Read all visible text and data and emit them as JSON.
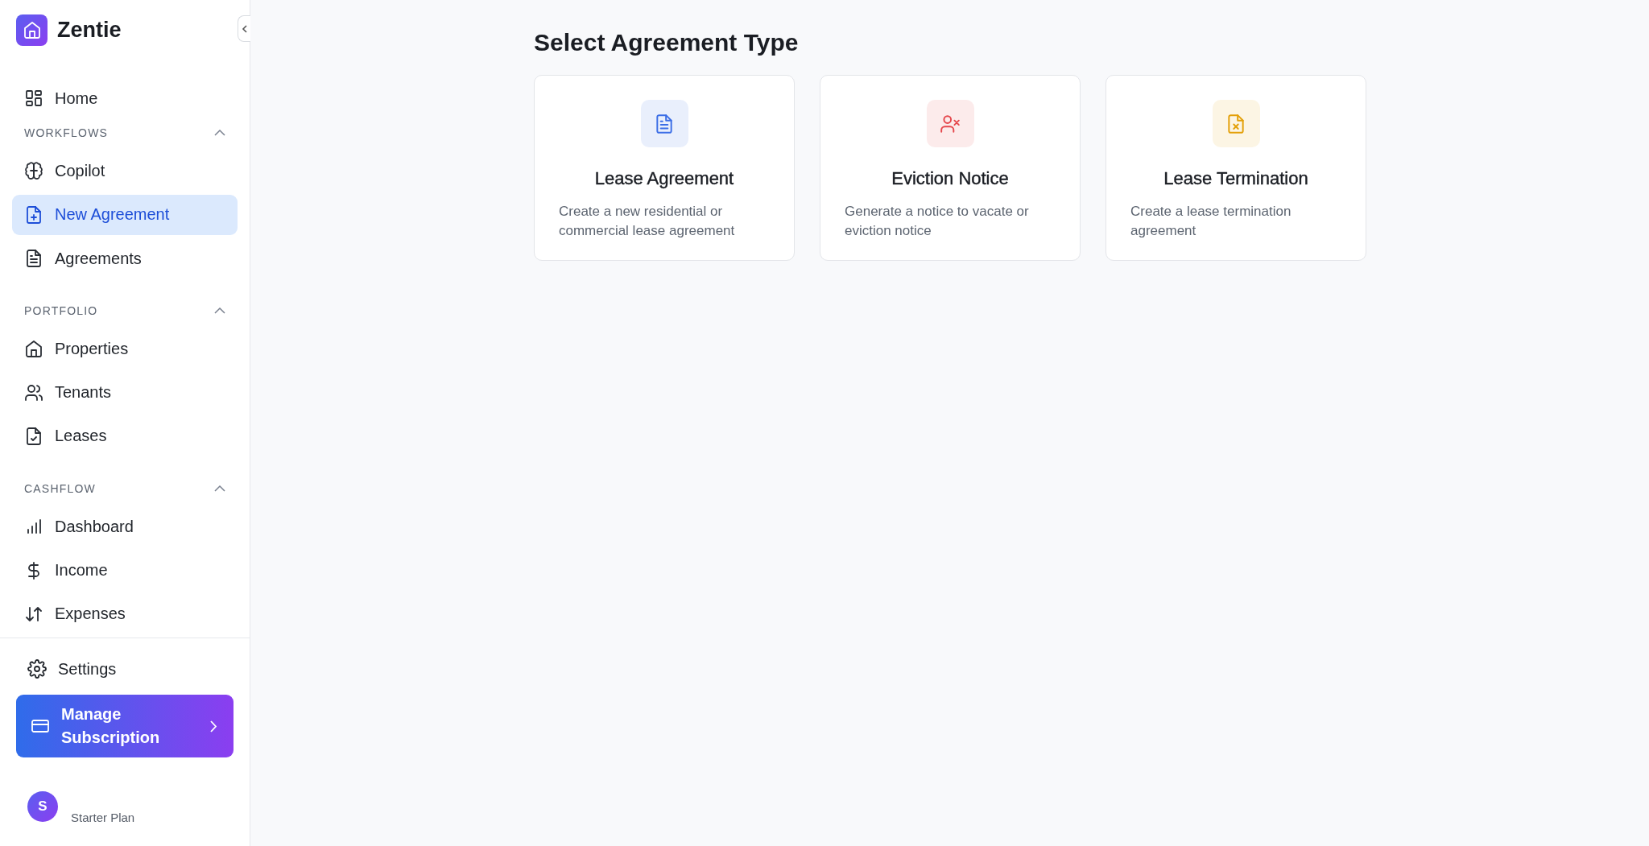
{
  "sidebar": {
    "brand": "Zentie",
    "nav": [
      {
        "kind": "item",
        "label": "Home",
        "selected": false
      },
      {
        "kind": "section",
        "label": "WORKFLOWS",
        "expanded": true
      },
      {
        "kind": "item",
        "label": "Copilot",
        "selected": false
      },
      {
        "kind": "item",
        "label": "New Agreement",
        "selected": true
      },
      {
        "kind": "item",
        "label": "Agreements",
        "selected": false
      },
      {
        "kind": "section",
        "label": "PORTFOLIO",
        "expanded": true
      },
      {
        "kind": "item",
        "label": "Properties",
        "selected": false
      },
      {
        "kind": "item",
        "label": "Tenants",
        "selected": false
      },
      {
        "kind": "item",
        "label": "Leases",
        "selected": false
      },
      {
        "kind": "section",
        "label": "CASHFLOW",
        "expanded": true
      },
      {
        "kind": "item",
        "label": "Dashboard",
        "selected": false
      },
      {
        "kind": "item",
        "label": "Income",
        "selected": false
      },
      {
        "kind": "item",
        "label": "Expenses",
        "selected": false
      }
    ],
    "settings": "Settings",
    "subscription": "Manage Subscription",
    "user": {
      "avatar": "S",
      "plan": "Starter Plan"
    }
  },
  "main": {
    "title": "Select Agreement Type",
    "cards": [
      {
        "title": "Lease Agreement",
        "description": "Create a new residential or commercial lease agreement",
        "color": "#3b6ee6"
      },
      {
        "title": "Eviction Notice",
        "description": "Generate a notice to vacate or eviction notice",
        "color": "#e5484d"
      },
      {
        "title": "Lease Termination",
        "description": "Create a lease termination agreement",
        "color": "#e3a008"
      }
    ]
  }
}
